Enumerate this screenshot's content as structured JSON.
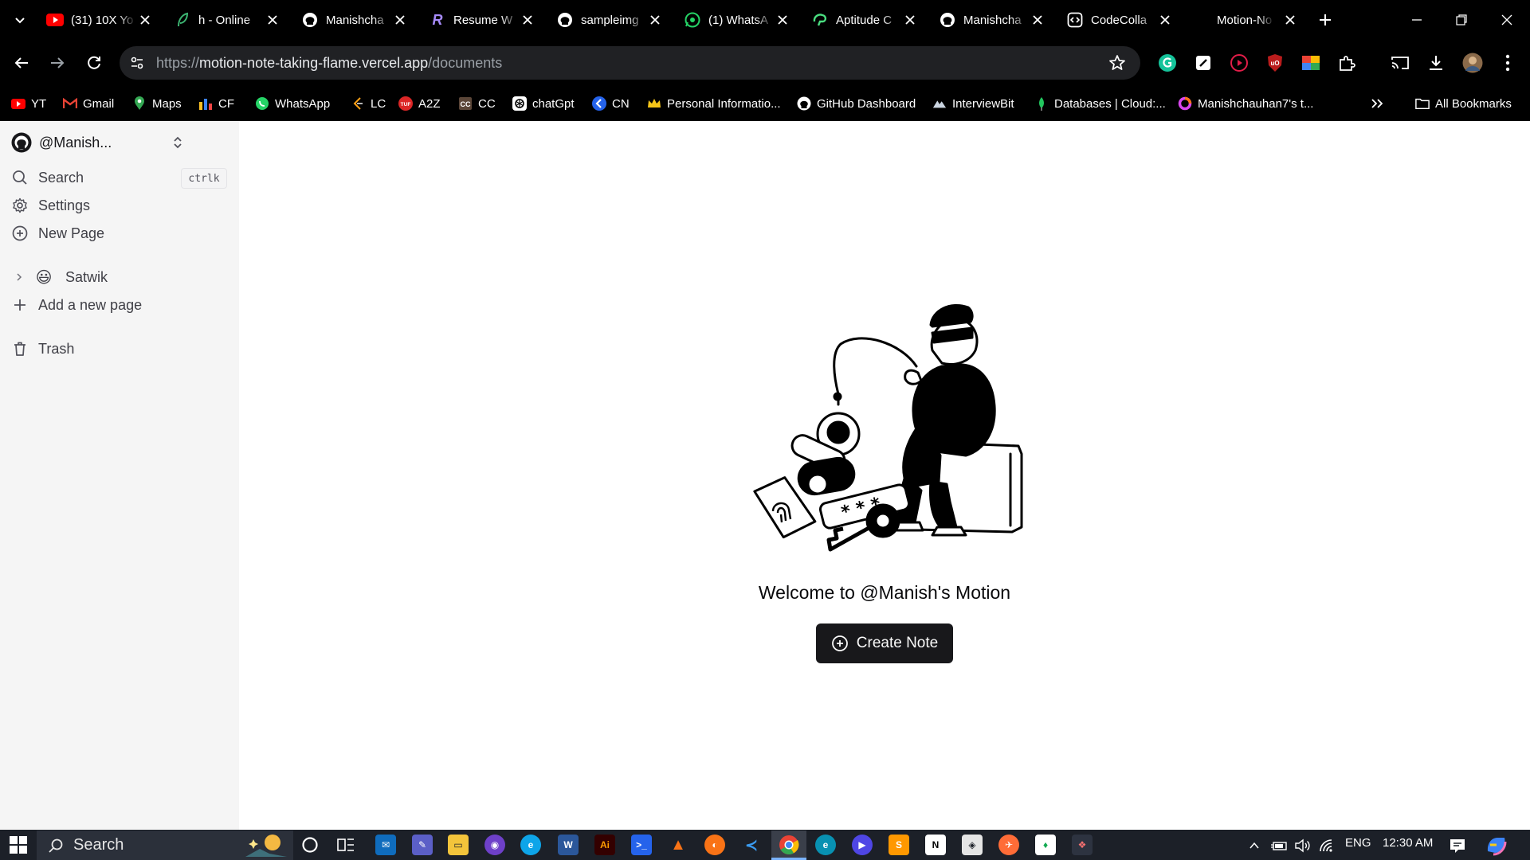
{
  "colors": {
    "chrome_bg": "#000000",
    "omnibox_bg": "#202124",
    "sidebar_bg": "#f5f5f5",
    "primary_button": "#18181b",
    "taskbar_bg": "#1c2028"
  },
  "tabs": [
    {
      "title": "(31) 10X Yo",
      "icon": "youtube-icon"
    },
    {
      "title": "h - Online",
      "icon": "leaf-icon"
    },
    {
      "title": "Manishcha",
      "icon": "github-icon"
    },
    {
      "title": "Resume W",
      "icon": "resume-r-icon"
    },
    {
      "title": "sampleimg",
      "icon": "github-icon"
    },
    {
      "title": "(1) WhatsA",
      "icon": "whatsapp-icon"
    },
    {
      "title": "Aptitude C",
      "icon": "brain-icon"
    },
    {
      "title": "Manishcha",
      "icon": "github-icon"
    },
    {
      "title": "CodeColla",
      "icon": "code-icon"
    },
    {
      "title": "Motion-No",
      "icon": "none",
      "active": true
    }
  ],
  "address_bar": {
    "scheme": "https://",
    "host": "motion-note-taking-flame.vercel.app",
    "path": "/documents"
  },
  "bookmarks": [
    {
      "label": "YT",
      "icon": "youtube-icon"
    },
    {
      "label": "Gmail",
      "icon": "gmail-icon"
    },
    {
      "label": "Maps",
      "icon": "maps-pin-icon"
    },
    {
      "label": "CF",
      "icon": "codeforces-icon"
    },
    {
      "label": "WhatsApp",
      "icon": "whatsapp-icon"
    },
    {
      "label": "LC",
      "icon": "leetcode-icon"
    },
    {
      "label": "A2Z",
      "icon": "tuf-icon"
    },
    {
      "label": "CC",
      "icon": "codechef-icon"
    },
    {
      "label": "chatGpt",
      "icon": "openai-icon"
    },
    {
      "label": "CN",
      "icon": "codingninjas-icon"
    },
    {
      "label": "Personal Informatio...",
      "icon": "crown-icon"
    },
    {
      "label": "GitHub Dashboard",
      "icon": "github-icon"
    },
    {
      "label": "InterviewBit",
      "icon": "interviewbit-icon"
    },
    {
      "label": "Databases | Cloud:...",
      "icon": "mongodb-leaf-icon"
    },
    {
      "label": "Manishchauhan7's t...",
      "icon": "ring-icon"
    }
  ],
  "all_bookmarks_label": "All Bookmarks",
  "sidebar": {
    "workspace": "@Manish...",
    "search_label": "Search",
    "search_shortcut": "ctrlk",
    "settings_label": "Settings",
    "new_page_label": "New Page",
    "documents": [
      {
        "title": "Satwik",
        "emoji": "😃"
      }
    ],
    "add_page_label": "Add a new page",
    "trash_label": "Trash"
  },
  "main": {
    "welcome_text": "Welcome to @Manish's Motion",
    "create_button_label": "Create Note"
  },
  "taskbar": {
    "search_placeholder": "Search",
    "language": "ENG",
    "time": "12:30 AM"
  }
}
